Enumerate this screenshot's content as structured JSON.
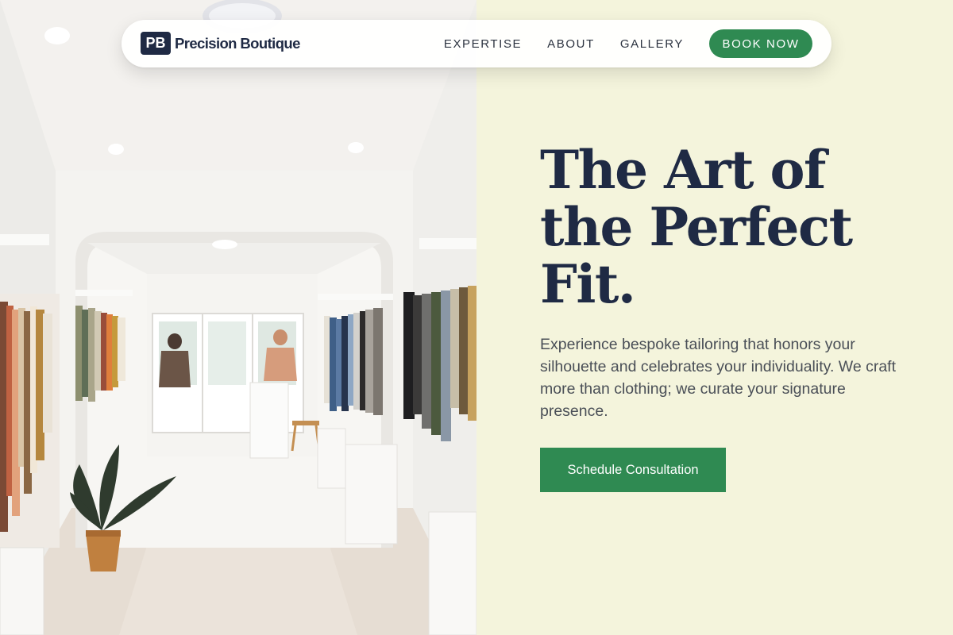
{
  "nav": {
    "brand_mark": "PB",
    "brand_name": "Precision Boutique",
    "links": [
      "EXPERTISE",
      "ABOUT",
      "GALLERY"
    ],
    "book_label": "BOOK NOW"
  },
  "hero": {
    "headline_lines": [
      "The Art of",
      "the Perfect",
      "Fit."
    ],
    "subtext": "Experience bespoke tailoring that honors your silhouette and celebrates your individuality. We craft more than clothing; we curate your signature presence.",
    "cta_label": "Schedule Consultation",
    "image_subject": "boutique interior with clothing racks"
  },
  "colors": {
    "navy": "#1f2a44",
    "green": "#2f8a52",
    "cream": "#f4f4dc",
    "body_text": "#4a4f57"
  }
}
